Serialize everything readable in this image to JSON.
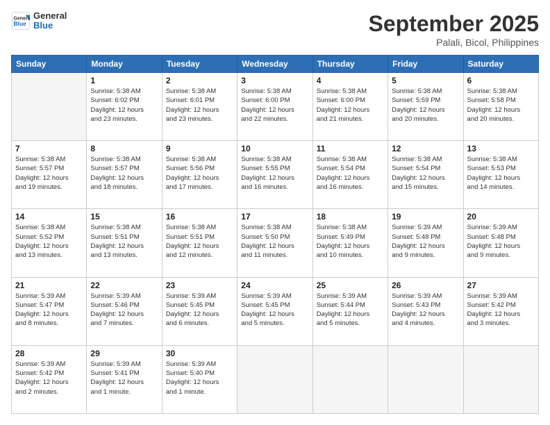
{
  "logo": {
    "general": "General",
    "blue": "Blue"
  },
  "header": {
    "month": "September 2025",
    "location": "Palali, Bicol, Philippines"
  },
  "weekdays": [
    "Sunday",
    "Monday",
    "Tuesday",
    "Wednesday",
    "Thursday",
    "Friday",
    "Saturday"
  ],
  "weeks": [
    [
      {
        "day": "",
        "info": ""
      },
      {
        "day": "1",
        "info": "Sunrise: 5:38 AM\nSunset: 6:02 PM\nDaylight: 12 hours\nand 23 minutes."
      },
      {
        "day": "2",
        "info": "Sunrise: 5:38 AM\nSunset: 6:01 PM\nDaylight: 12 hours\nand 23 minutes."
      },
      {
        "day": "3",
        "info": "Sunrise: 5:38 AM\nSunset: 6:00 PM\nDaylight: 12 hours\nand 22 minutes."
      },
      {
        "day": "4",
        "info": "Sunrise: 5:38 AM\nSunset: 6:00 PM\nDaylight: 12 hours\nand 21 minutes."
      },
      {
        "day": "5",
        "info": "Sunrise: 5:38 AM\nSunset: 5:59 PM\nDaylight: 12 hours\nand 20 minutes."
      },
      {
        "day": "6",
        "info": "Sunrise: 5:38 AM\nSunset: 5:58 PM\nDaylight: 12 hours\nand 20 minutes."
      }
    ],
    [
      {
        "day": "7",
        "info": "Sunrise: 5:38 AM\nSunset: 5:57 PM\nDaylight: 12 hours\nand 19 minutes."
      },
      {
        "day": "8",
        "info": "Sunrise: 5:38 AM\nSunset: 5:57 PM\nDaylight: 12 hours\nand 18 minutes."
      },
      {
        "day": "9",
        "info": "Sunrise: 5:38 AM\nSunset: 5:56 PM\nDaylight: 12 hours\nand 17 minutes."
      },
      {
        "day": "10",
        "info": "Sunrise: 5:38 AM\nSunset: 5:55 PM\nDaylight: 12 hours\nand 16 minutes."
      },
      {
        "day": "11",
        "info": "Sunrise: 5:38 AM\nSunset: 5:54 PM\nDaylight: 12 hours\nand 16 minutes."
      },
      {
        "day": "12",
        "info": "Sunrise: 5:38 AM\nSunset: 5:54 PM\nDaylight: 12 hours\nand 15 minutes."
      },
      {
        "day": "13",
        "info": "Sunrise: 5:38 AM\nSunset: 5:53 PM\nDaylight: 12 hours\nand 14 minutes."
      }
    ],
    [
      {
        "day": "14",
        "info": "Sunrise: 5:38 AM\nSunset: 5:52 PM\nDaylight: 12 hours\nand 13 minutes."
      },
      {
        "day": "15",
        "info": "Sunrise: 5:38 AM\nSunset: 5:51 PM\nDaylight: 12 hours\nand 13 minutes."
      },
      {
        "day": "16",
        "info": "Sunrise: 5:38 AM\nSunset: 5:51 PM\nDaylight: 12 hours\nand 12 minutes."
      },
      {
        "day": "17",
        "info": "Sunrise: 5:38 AM\nSunset: 5:50 PM\nDaylight: 12 hours\nand 11 minutes."
      },
      {
        "day": "18",
        "info": "Sunrise: 5:38 AM\nSunset: 5:49 PM\nDaylight: 12 hours\nand 10 minutes."
      },
      {
        "day": "19",
        "info": "Sunrise: 5:39 AM\nSunset: 5:48 PM\nDaylight: 12 hours\nand 9 minutes."
      },
      {
        "day": "20",
        "info": "Sunrise: 5:39 AM\nSunset: 5:48 PM\nDaylight: 12 hours\nand 9 minutes."
      }
    ],
    [
      {
        "day": "21",
        "info": "Sunrise: 5:39 AM\nSunset: 5:47 PM\nDaylight: 12 hours\nand 8 minutes."
      },
      {
        "day": "22",
        "info": "Sunrise: 5:39 AM\nSunset: 5:46 PM\nDaylight: 12 hours\nand 7 minutes."
      },
      {
        "day": "23",
        "info": "Sunrise: 5:39 AM\nSunset: 5:45 PM\nDaylight: 12 hours\nand 6 minutes."
      },
      {
        "day": "24",
        "info": "Sunrise: 5:39 AM\nSunset: 5:45 PM\nDaylight: 12 hours\nand 5 minutes."
      },
      {
        "day": "25",
        "info": "Sunrise: 5:39 AM\nSunset: 5:44 PM\nDaylight: 12 hours\nand 5 minutes."
      },
      {
        "day": "26",
        "info": "Sunrise: 5:39 AM\nSunset: 5:43 PM\nDaylight: 12 hours\nand 4 minutes."
      },
      {
        "day": "27",
        "info": "Sunrise: 5:39 AM\nSunset: 5:42 PM\nDaylight: 12 hours\nand 3 minutes."
      }
    ],
    [
      {
        "day": "28",
        "info": "Sunrise: 5:39 AM\nSunset: 5:42 PM\nDaylight: 12 hours\nand 2 minutes."
      },
      {
        "day": "29",
        "info": "Sunrise: 5:39 AM\nSunset: 5:41 PM\nDaylight: 12 hours\nand 1 minute."
      },
      {
        "day": "30",
        "info": "Sunrise: 5:39 AM\nSunset: 5:40 PM\nDaylight: 12 hours\nand 1 minute."
      },
      {
        "day": "",
        "info": ""
      },
      {
        "day": "",
        "info": ""
      },
      {
        "day": "",
        "info": ""
      },
      {
        "day": "",
        "info": ""
      }
    ]
  ]
}
